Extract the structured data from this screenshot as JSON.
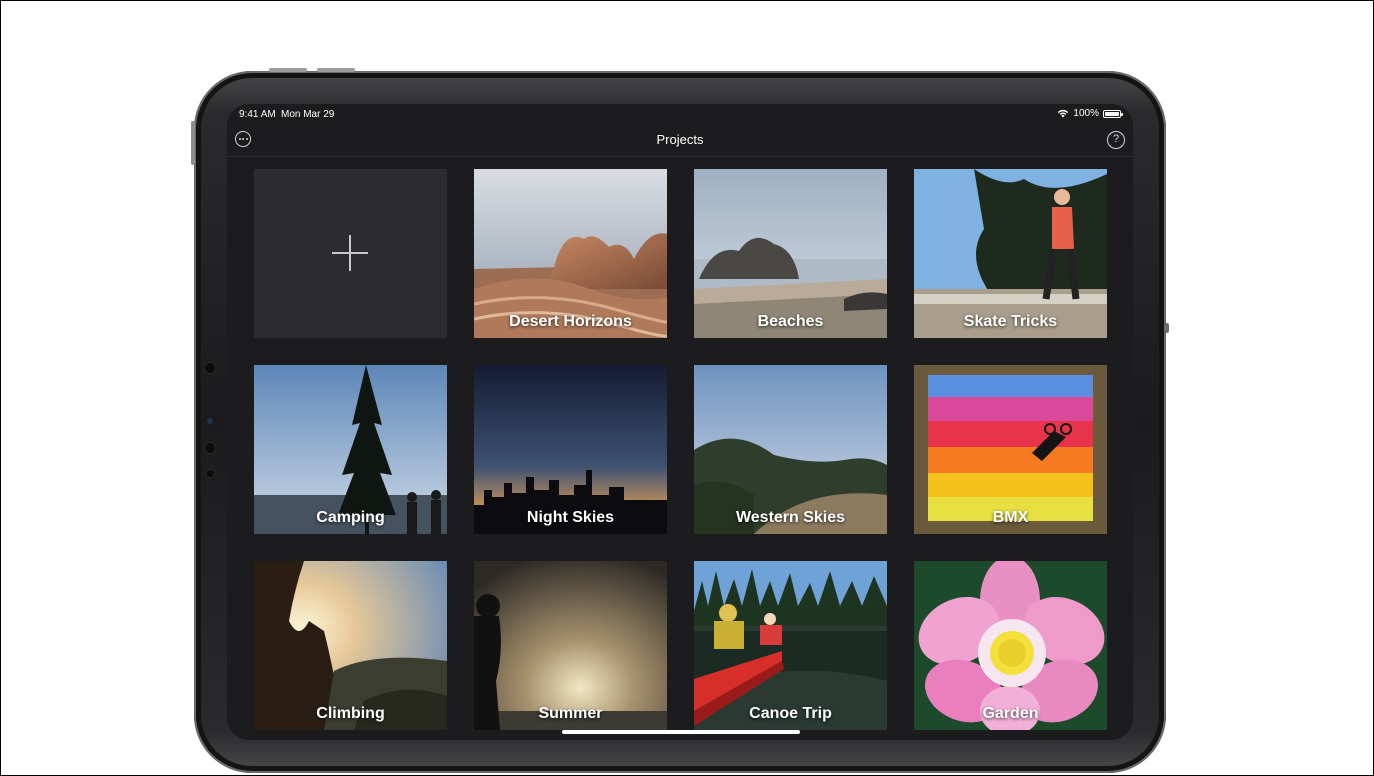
{
  "status_bar": {
    "time": "9:41 AM",
    "date": "Mon Mar 29",
    "battery": "100%"
  },
  "nav": {
    "title": "Projects",
    "more_icon": "ellipsis-circle-icon",
    "help_icon": "question-circle-icon",
    "help_glyph": "?"
  },
  "new_project": {
    "icon": "plus-icon"
  },
  "projects": [
    {
      "label": "Desert Horizons"
    },
    {
      "label": "Beaches"
    },
    {
      "label": "Skate Tricks"
    },
    {
      "label": "Camping"
    },
    {
      "label": "Night Skies"
    },
    {
      "label": "Western Skies"
    },
    {
      "label": "BMX"
    },
    {
      "label": "Climbing"
    },
    {
      "label": "Summer"
    },
    {
      "label": "Canoe Trip"
    },
    {
      "label": "Garden"
    }
  ]
}
